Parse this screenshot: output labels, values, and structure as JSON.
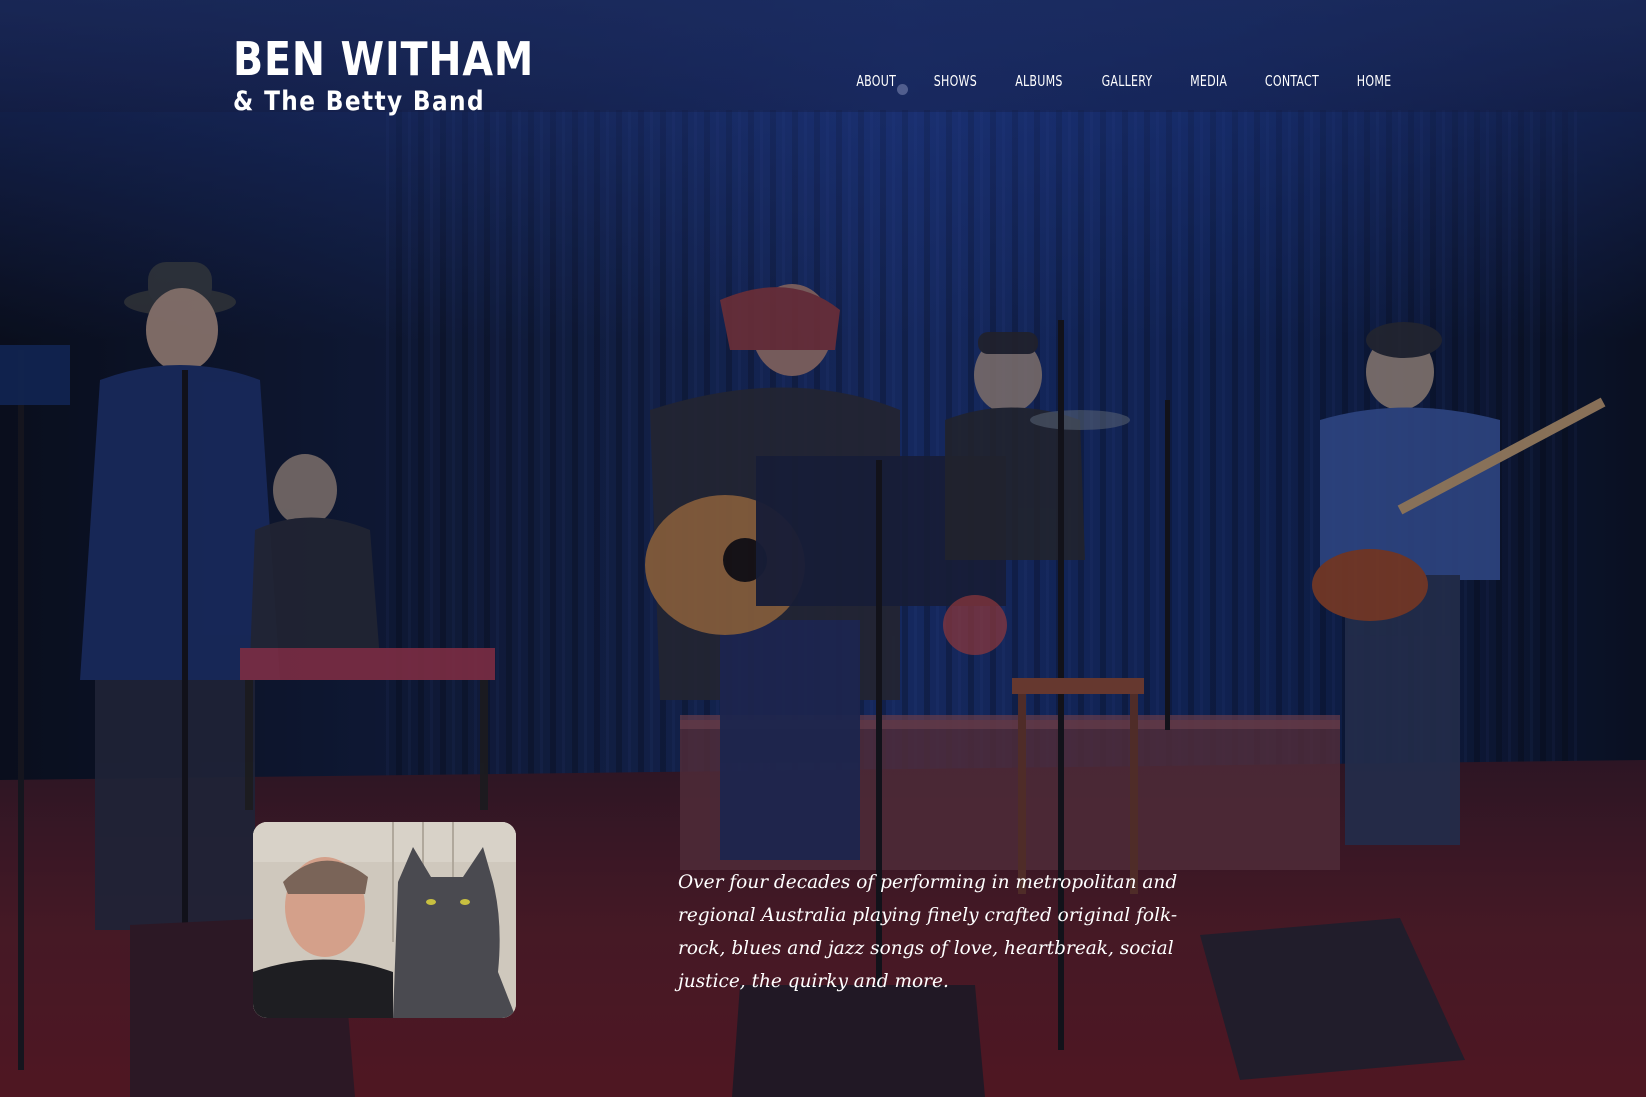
{
  "site": {
    "brand_name": "BEN WITHAM",
    "brand_sub": "& The Betty Band"
  },
  "nav": {
    "items": [
      {
        "label": "ABOUT"
      },
      {
        "label": "SHOWS"
      },
      {
        "label": "ALBUMS"
      },
      {
        "label": "GALLERY"
      },
      {
        "label": "MEDIA"
      },
      {
        "label": "CONTACT"
      },
      {
        "label": "HOME"
      }
    ]
  },
  "hero": {
    "tagline": "Over four decades of performing in metropolitan and regional Australia playing finely crafted original folk-rock, blues and jazz songs of love, heartbreak, social justice, the quirky and more."
  },
  "colors": {
    "overlay_top": "#1a264e",
    "stage_floor": "#5a1e2a",
    "curtain": "#0e1a3c",
    "text": "#ffffff"
  }
}
